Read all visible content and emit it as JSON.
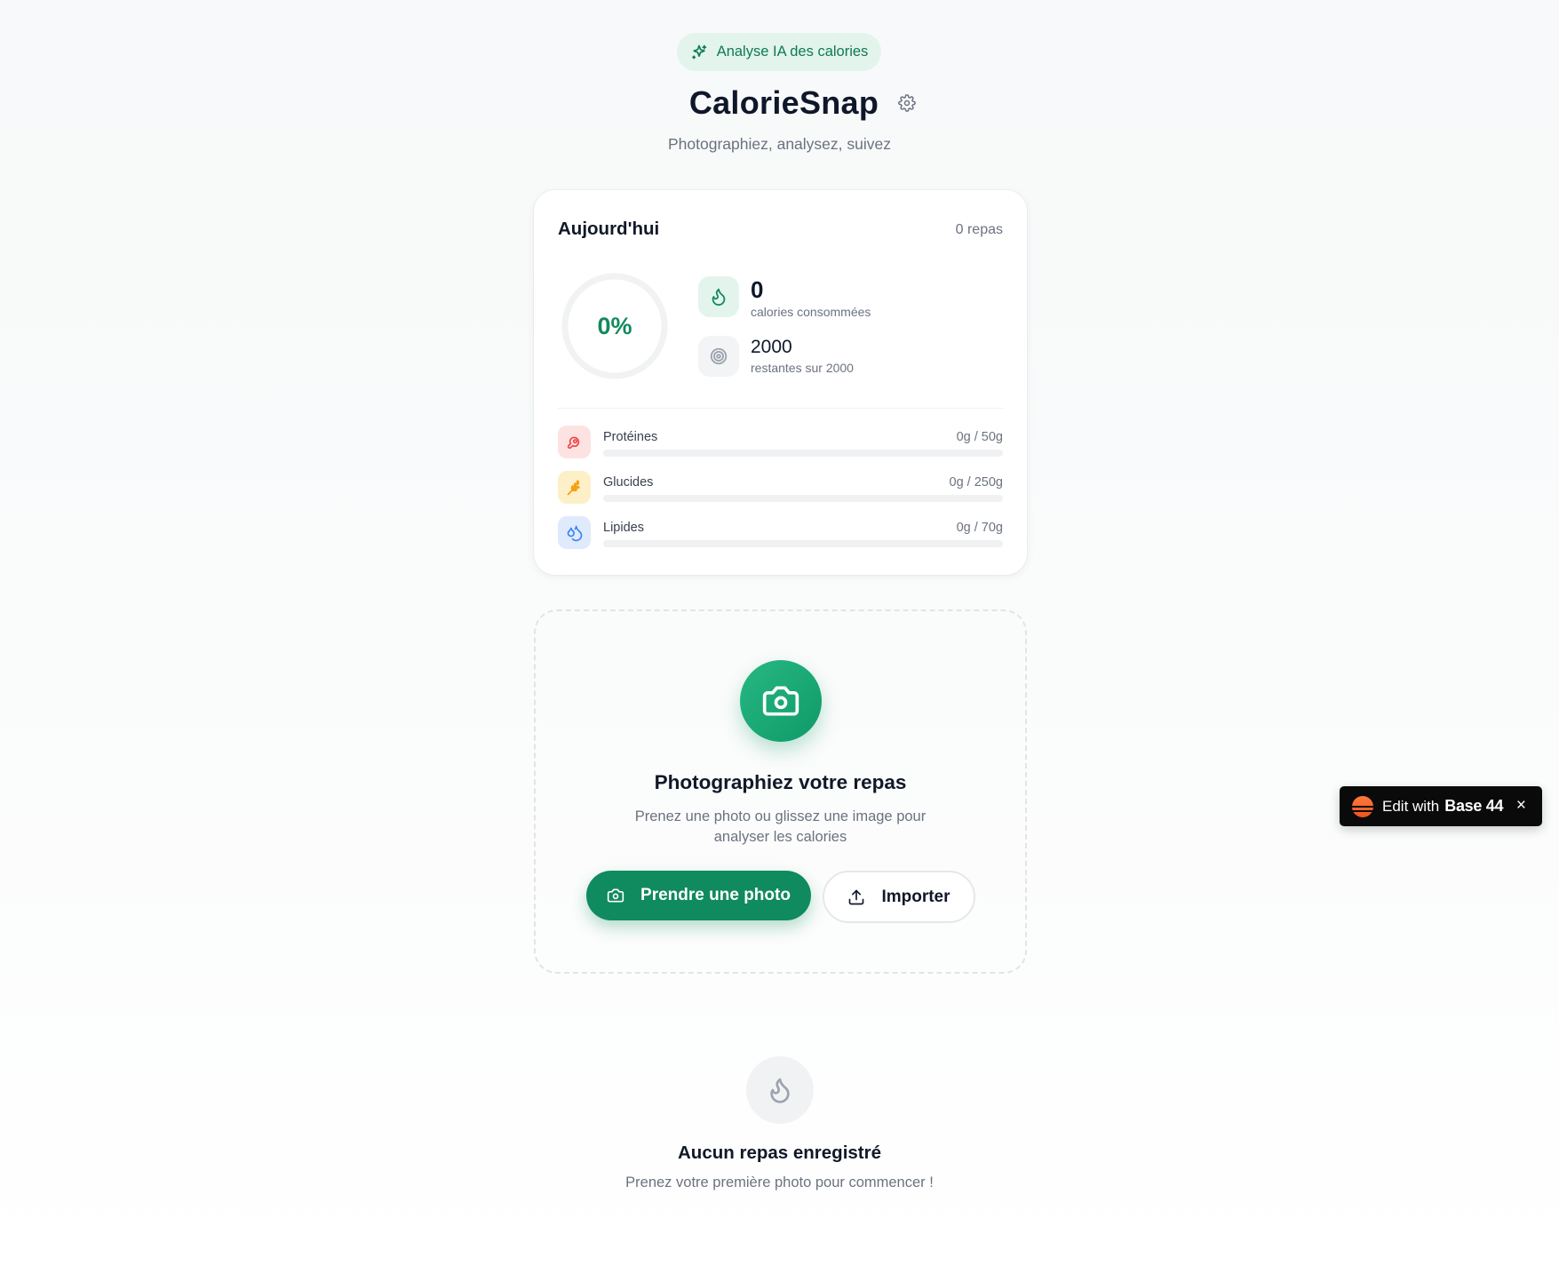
{
  "header": {
    "badge_label": "Analyse IA des calories",
    "app_title": "CalorieSnap",
    "subtitle": "Photographiez, analysez, suivez"
  },
  "today": {
    "title": "Aujourd'hui",
    "meals_count": "0 repas",
    "progress_label": "0%",
    "progress_fraction": 0,
    "consumed_value": "0",
    "consumed_label": "calories consommées",
    "remaining_value": "2000",
    "remaining_label": "restantes sur 2000",
    "macros": [
      {
        "name": "Protéines",
        "value": "0g / 50g",
        "fraction": 0,
        "color": "#ef4444",
        "bg": "#fde2e2",
        "icon": "meat-icon"
      },
      {
        "name": "Glucides",
        "value": "0g / 250g",
        "fraction": 0,
        "color": "#f59e0b",
        "bg": "#fdf0c9",
        "icon": "wheat-icon"
      },
      {
        "name": "Lipides",
        "value": "0g / 70g",
        "fraction": 0,
        "color": "#3b82f6",
        "bg": "#dfeafd",
        "icon": "droplets-icon"
      }
    ]
  },
  "upload": {
    "title": "Photographiez votre repas",
    "description": "Prenez une photo ou glissez une image pour analyser les calories",
    "take_photo_label": "Prendre une photo",
    "import_label": "Importer"
  },
  "empty_state": {
    "title": "Aucun repas enregistré",
    "subtitle": "Prenez votre première photo pour commencer !"
  },
  "base44": {
    "text": "Edit with",
    "brand": "Base 44",
    "close": "×"
  },
  "colors": {
    "accent": "#108a5f",
    "accent_light": "#e3f4ec",
    "text_muted": "#6b7280"
  }
}
